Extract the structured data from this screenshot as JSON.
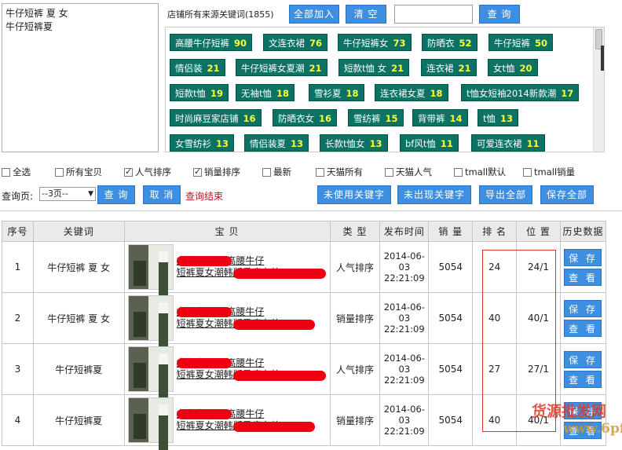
{
  "keyword_input": {
    "lines": [
      "牛仔短裤 夏 女",
      "牛仔短裤夏"
    ]
  },
  "source_title": "店铺所有来源关键词(1855)",
  "toolbar": {
    "add_all": "全部加入",
    "clear": "清 空",
    "search_value": "",
    "query": "查 询"
  },
  "tags": [
    {
      "label": "高腰牛仔短裤",
      "count": "90"
    },
    {
      "label": "文连衣裙",
      "count": "76"
    },
    {
      "label": "牛仔短裤女",
      "count": "73"
    },
    {
      "label": "防晒衣",
      "count": "52"
    },
    {
      "label": "牛仔短裤",
      "count": "50"
    },
    {
      "label": "情侣装",
      "count": "21"
    },
    {
      "label": "牛仔短裤女夏潮",
      "count": "21"
    },
    {
      "label": "短款t恤 女",
      "count": "21"
    },
    {
      "label": "连衣裙",
      "count": "21"
    },
    {
      "label": "女t恤",
      "count": "20"
    },
    {
      "label": "短款t恤",
      "count": "19"
    },
    {
      "label": "无袖t恤",
      "count": "18"
    },
    {
      "label": "雪衫夏",
      "count": "18"
    },
    {
      "label": "连衣裙女夏",
      "count": "18"
    },
    {
      "label": "t恤女短袖2014新款潮",
      "count": "17"
    },
    {
      "label": "时尚麻豆家店铺",
      "count": "16"
    },
    {
      "label": "防晒衣女",
      "count": "16"
    },
    {
      "label": "雪纺裤",
      "count": "15"
    },
    {
      "label": "背带裤",
      "count": "14"
    },
    {
      "label": "t恤",
      "count": "13"
    },
    {
      "label": "女雪纺衫",
      "count": "13"
    },
    {
      "label": "情侣装夏",
      "count": "13"
    },
    {
      "label": "长款t恤女",
      "count": "13"
    },
    {
      "label": "bf风t恤",
      "count": "11"
    },
    {
      "label": "可爱连衣裙",
      "count": "11"
    }
  ],
  "filters": [
    {
      "label": "全选",
      "checked": false
    },
    {
      "label": "所有宝贝",
      "checked": false
    },
    {
      "label": "人气排序",
      "checked": true
    },
    {
      "label": "销量排序",
      "checked": true
    },
    {
      "label": "最新",
      "checked": false
    },
    {
      "label": "天猫所有",
      "checked": false
    },
    {
      "label": "天猫人气",
      "checked": false
    },
    {
      "label": "tmall默认",
      "checked": false
    },
    {
      "label": "tmall销量",
      "checked": false
    }
  ],
  "query_bar": {
    "label": "查询页:",
    "page_select": "--3页--",
    "query": "查 询",
    "cancel": "取 消",
    "status": "查询结束",
    "unused_kw": "未使用关键字",
    "unseen_kw": "未出现关键字",
    "export_all": "导出全部",
    "save_all": "保存全部"
  },
  "table": {
    "headers": [
      "序号",
      "关键词",
      "宝 贝",
      "类 型",
      "发布时间",
      "销 量",
      "排 名",
      "位 置",
      "历史数据"
    ],
    "rows": [
      {
        "idx": "1",
        "keyword": "牛仔短裤 夏 女",
        "title1": "女士牛仔裤 高腰牛仔",
        "title2": "短裤夏女潮韩版显瘦女装",
        "type": "人气排序",
        "date": "2014-06-03",
        "time": "22:21:09",
        "sales": "5054",
        "rank": "24",
        "pos": "24/1"
      },
      {
        "idx": "2",
        "keyword": "牛仔短裤 夏 女",
        "title1": "女士牛仔裤 高腰牛仔",
        "title2": "短裤夏女潮韩版显瘦女装",
        "type": "销量排序",
        "date": "2014-06-03",
        "time": "22:21:09",
        "sales": "5054",
        "rank": "40",
        "pos": "40/1"
      },
      {
        "idx": "3",
        "keyword": "牛仔短裤夏",
        "title1": "女士牛仔裤 高腰牛仔",
        "title2": "短裤夏女潮韩版显瘦女装",
        "type": "人气排序",
        "date": "2014-06-03",
        "time": "22:21:09",
        "sales": "5054",
        "rank": "27",
        "pos": "27/1"
      },
      {
        "idx": "4",
        "keyword": "牛仔短裤夏",
        "title1": "女士牛仔裤 高腰牛仔",
        "title2": "短裤夏女潮韩版显瘦女装",
        "type": "销量排序",
        "date": "2014-06-03",
        "time": "22:21:09",
        "sales": "5054",
        "rank": "40",
        "pos": "40/1"
      }
    ],
    "save_label": "保 存",
    "view_label": "查 看"
  },
  "watermark": {
    "text": "货源批发网",
    "url": "www.6pf.cn"
  }
}
